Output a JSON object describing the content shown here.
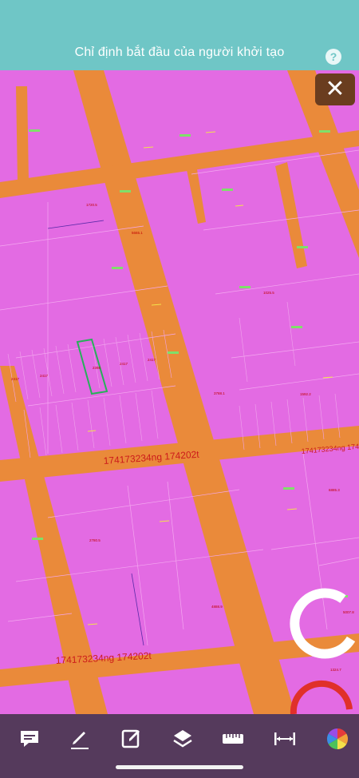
{
  "header": {
    "title": "Chỉ định bắt đầu của người khởi tạo",
    "help_label": "?"
  },
  "map": {
    "road_label_upper": "174173234ng 174202t",
    "road_label_lower": "174173234ng 174202t",
    "parcel_codes": [
      "2417",
      "2417",
      "2398",
      "2417",
      "2417",
      "1720.5",
      "5665.1",
      "3788.1",
      "1592.2",
      "2780.5",
      "4888.9",
      "6885.3",
      "1025.5",
      "5007.8",
      "1324.7"
    ],
    "colors": {
      "parcel": "#e36be3",
      "road": "#ea8a3a",
      "highlight": "#27b05a"
    }
  },
  "controls": {
    "close_label": "✕"
  },
  "toolbar": {
    "icons": [
      "comment-icon",
      "pencil-icon",
      "edit-note-icon",
      "layers-icon",
      "ruler-icon",
      "measure-distance-icon",
      "color-wheel-icon"
    ]
  }
}
